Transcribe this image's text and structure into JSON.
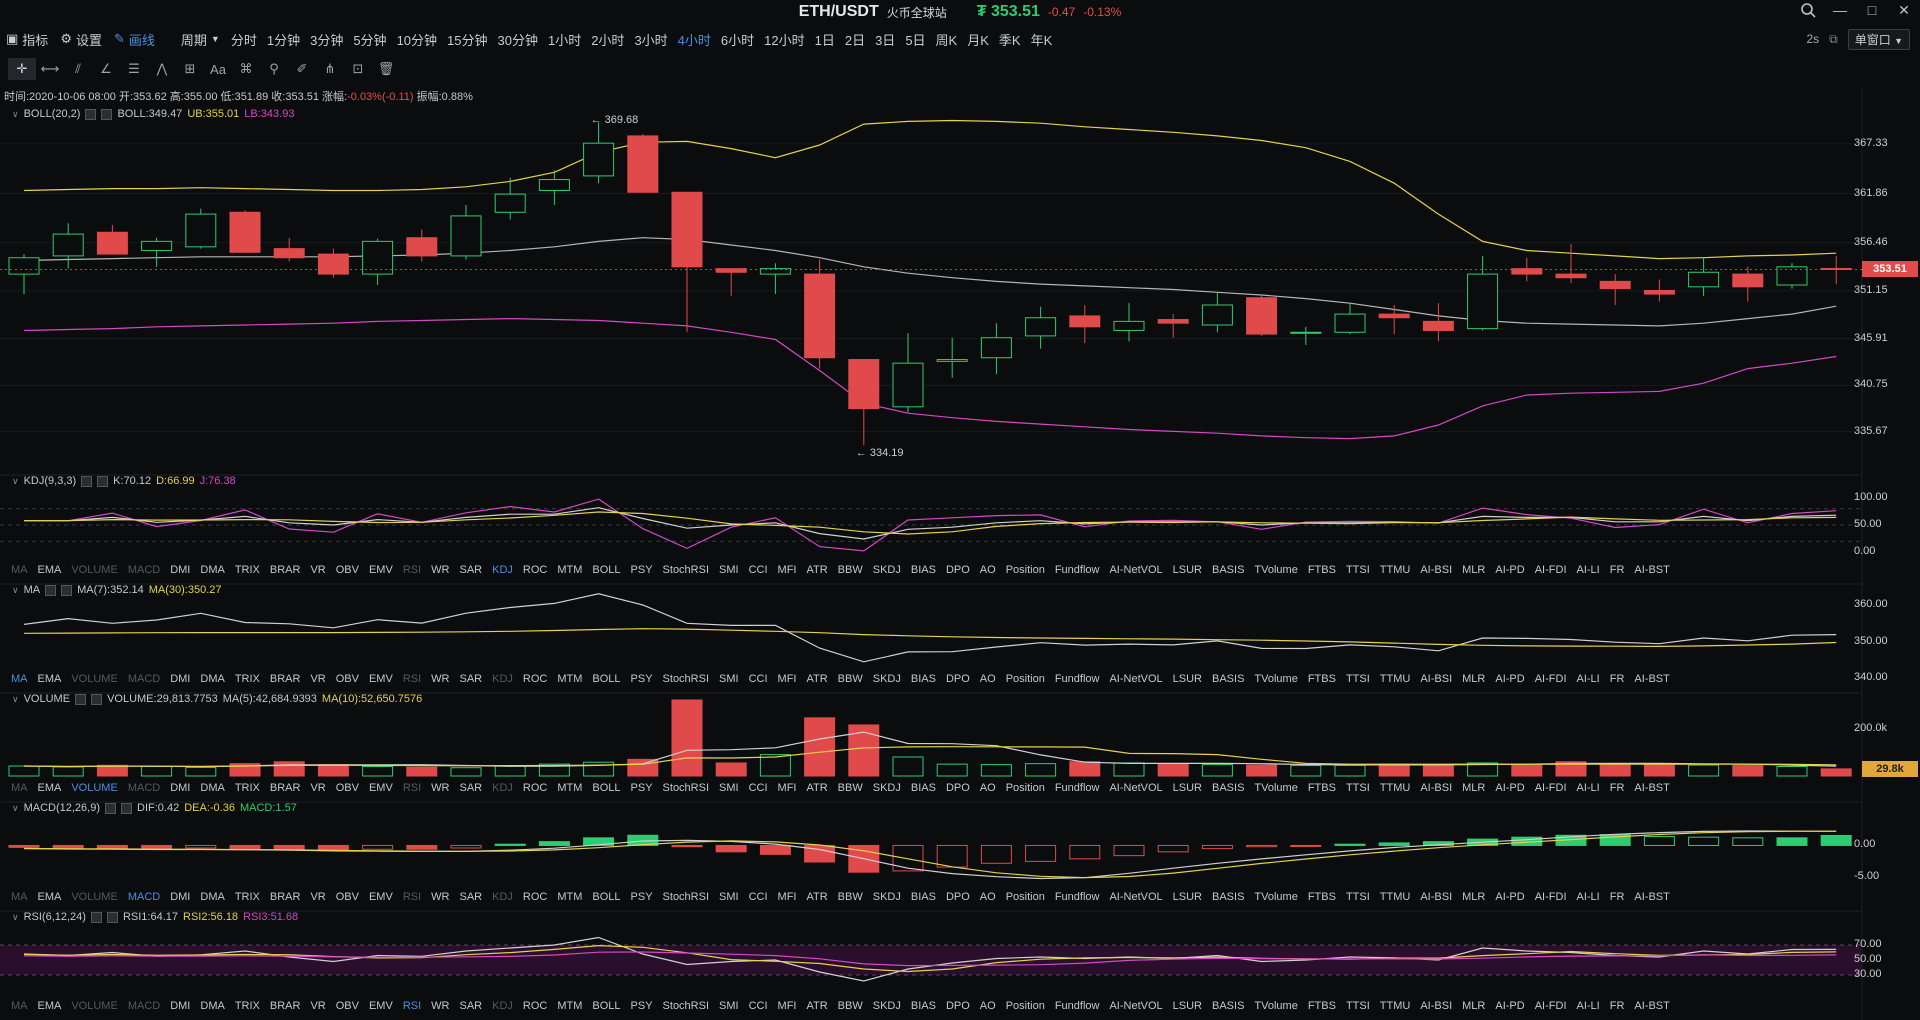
{
  "title": {
    "pair": "ETH/USDT",
    "exchange": "火币全球站",
    "price": "₮ 353.51",
    "change": "-0.47",
    "change_pct": "-0.13%"
  },
  "window_buttons": [
    "—",
    "□",
    "✕"
  ],
  "toolbar": {
    "indicator": "指标",
    "settings": "设置",
    "draw": "画线",
    "period_menu": "周期"
  },
  "periods": [
    "分时",
    "1分钟",
    "3分钟",
    "5分钟",
    "10分钟",
    "15分钟",
    "30分钟",
    "1小时",
    "2小时",
    "3小时",
    "4小时",
    "6小时",
    "12小时",
    "1日",
    "2日",
    "3日",
    "5日",
    "周K",
    "月K",
    "季K",
    "年K"
  ],
  "active_period": "4小时",
  "period_right": {
    "interval": "2s",
    "window_select": "单窗口"
  },
  "draw_tools": [
    "crosshair",
    "ray-line",
    "parallel",
    "angle",
    "fib",
    "channel",
    "rect",
    "text",
    "pattern",
    "measure",
    "brush",
    "magnet",
    "lock",
    "trash"
  ],
  "draw_text_label": "Aa",
  "info": {
    "time": "时间:2020-10-06 08:00",
    "open": "开:353.62",
    "high": "高:355.00",
    "low": "低:351.89",
    "close": "收:353.51",
    "chg_label": "涨幅:",
    "chg": "-0.03%(-0.11)",
    "amp": "振幅:0.88%"
  },
  "main": {
    "indicator": "BOLL(20,2)",
    "mid": "BOLL:349.47",
    "ub": "UB:355.01",
    "lb": "LB:343.93",
    "y_ticks": [
      "367.33",
      "361.86",
      "356.46",
      "351.15",
      "345.91",
      "340.75",
      "335.67"
    ],
    "current_price": "353.51",
    "hi_label": "← 369.68",
    "lo_label": "← 334.19",
    "colors": {
      "up": "#2ecc71",
      "down": "#e04a4a",
      "ub": "#e3d24a",
      "mid": "#b5b5b5",
      "lb": "#d548c6"
    }
  },
  "kdj": {
    "indicator": "KDJ(9,3,3)",
    "k": "K:70.12",
    "d": "D:66.99",
    "j": "J:76.38",
    "y_ticks": [
      "100.00",
      "50.00",
      "0.00"
    ]
  },
  "ma": {
    "indicator": "MA",
    "ma7": "MA(7):352.14",
    "ma30": "MA(30):350.27",
    "y_ticks": [
      "360.00",
      "350.00",
      "340.00"
    ]
  },
  "volume": {
    "indicator": "VOLUME",
    "vol": "VOLUME:29,813.7753",
    "ma5": "MA(5):42,684.9393",
    "ma10": "MA(10):52,650.7576",
    "y_ticks": [
      "200.0k"
    ],
    "current": "29.8k"
  },
  "macd": {
    "indicator": "MACD(12,26,9)",
    "dif": "DIF:0.42",
    "dea": "DEA:-0.36",
    "macd": "MACD:1.57",
    "y_ticks": [
      "0.00",
      "-5.00"
    ]
  },
  "rsi": {
    "indicator": "RSI(6,12,24)",
    "rsi1": "RSI1:64.17",
    "rsi2": "RSI2:56.18",
    "rsi3": "RSI3:51.68",
    "y_ticks": [
      "70.00",
      "50.00",
      "30.00"
    ]
  },
  "indicator_tabs": [
    "MA",
    "EMA",
    "VOLUME",
    "MACD",
    "DMI",
    "DMA",
    "TRIX",
    "BRAR",
    "VR",
    "OBV",
    "EMV",
    "RSI",
    "WR",
    "SAR",
    "KDJ",
    "ROC",
    "MTM",
    "BOLL",
    "PSY",
    "StochRSI",
    "SMI",
    "CCI",
    "MFI",
    "ATR",
    "BBW",
    "SKDJ",
    "BIAS",
    "DPO",
    "AO",
    "Position",
    "Fundflow",
    "AI-NetVOL",
    "LSUR",
    "BASIS",
    "TVolume",
    "FTBS",
    "TTSI",
    "TTMU",
    "AI-BSI",
    "MLR",
    "AI-PD",
    "AI-FDI",
    "AI-LI",
    "FR",
    "AI-BST"
  ],
  "candles": [
    [
      353.0,
      355.2,
      350.8,
      354.8
    ],
    [
      355.0,
      358.6,
      353.6,
      357.4
    ],
    [
      357.6,
      358.4,
      355.2,
      355.2
    ],
    [
      355.6,
      357.0,
      353.8,
      356.6
    ],
    [
      356.0,
      360.2,
      355.8,
      359.6
    ],
    [
      359.8,
      360.0,
      355.4,
      355.4
    ],
    [
      355.8,
      357.0,
      354.4,
      354.8
    ],
    [
      355.2,
      355.8,
      352.6,
      353.0
    ],
    [
      353.0,
      356.9,
      351.8,
      356.6
    ],
    [
      357.0,
      357.9,
      354.4,
      355.0
    ],
    [
      355.0,
      360.6,
      354.6,
      359.4
    ],
    [
      359.8,
      363.6,
      359.0,
      361.8
    ],
    [
      362.2,
      364.4,
      360.6,
      363.4
    ],
    [
      363.8,
      369.68,
      363.0,
      367.4
    ],
    [
      368.2,
      368.4,
      362.0,
      362.0
    ],
    [
      362.0,
      362.0,
      346.6,
      353.8
    ],
    [
      353.6,
      353.6,
      350.6,
      353.2
    ],
    [
      353.0,
      354.2,
      350.8,
      353.6
    ],
    [
      353.0,
      354.6,
      342.6,
      343.8
    ],
    [
      343.6,
      343.6,
      334.19,
      338.2
    ],
    [
      338.4,
      346.5,
      337.8,
      343.2
    ],
    [
      343.4,
      346.0,
      341.6,
      343.6
    ],
    [
      343.8,
      347.6,
      342.0,
      346.0
    ],
    [
      346.2,
      349.4,
      344.8,
      348.2
    ],
    [
      348.4,
      349.6,
      345.4,
      347.2
    ],
    [
      346.8,
      349.8,
      345.6,
      347.8
    ],
    [
      348.0,
      348.6,
      346.0,
      347.6
    ],
    [
      347.4,
      351.0,
      346.6,
      349.6
    ],
    [
      350.4,
      350.6,
      346.2,
      346.4
    ],
    [
      346.6,
      347.2,
      345.2,
      346.6
    ],
    [
      346.6,
      349.8,
      346.4,
      348.6
    ],
    [
      348.6,
      349.6,
      346.4,
      348.2
    ],
    [
      347.8,
      349.8,
      345.6,
      346.8
    ],
    [
      347.0,
      355.0,
      346.8,
      353.0
    ],
    [
      353.6,
      354.8,
      352.2,
      353.0
    ],
    [
      353.0,
      356.3,
      352.0,
      352.6
    ],
    [
      352.2,
      353.0,
      349.6,
      351.4
    ],
    [
      351.2,
      352.4,
      350.0,
      350.8
    ],
    [
      351.6,
      354.8,
      350.6,
      353.2
    ],
    [
      353.0,
      353.8,
      350.0,
      351.6
    ],
    [
      351.8,
      354.2,
      351.4,
      353.8
    ],
    [
      353.62,
      355.0,
      351.89,
      353.51
    ]
  ],
  "boll_ub": [
    362.2,
    362.3,
    362.4,
    362.4,
    362.5,
    362.4,
    362.3,
    362.2,
    362.2,
    362.3,
    362.6,
    363.2,
    364.2,
    366.4,
    367.5,
    367.6,
    366.8,
    365.8,
    367.2,
    369.5,
    369.8,
    369.9,
    369.8,
    369.6,
    369.2,
    368.9,
    368.6,
    368.2,
    367.7,
    366.9,
    365.4,
    363.0,
    359.6,
    356.6,
    355.6,
    355.3,
    355.0,
    354.7,
    354.8,
    355.0,
    355.1,
    355.3
  ],
  "boll_mid": [
    354.5,
    354.6,
    354.7,
    354.8,
    354.9,
    354.9,
    354.9,
    354.9,
    355.0,
    355.1,
    355.3,
    355.6,
    356.0,
    356.6,
    357.0,
    356.8,
    356.2,
    355.6,
    354.8,
    353.8,
    353.1,
    352.6,
    352.2,
    351.9,
    351.7,
    351.5,
    351.3,
    351.0,
    350.7,
    350.3,
    349.8,
    349.1,
    348.4,
    347.9,
    347.6,
    347.5,
    347.4,
    347.3,
    347.6,
    348.1,
    348.6,
    349.47
  ],
  "boll_lb": [
    346.8,
    346.9,
    347.0,
    347.2,
    347.3,
    347.4,
    347.5,
    347.6,
    347.8,
    347.9,
    348.0,
    348.1,
    348.0,
    347.9,
    347.6,
    347.3,
    346.6,
    345.8,
    342.4,
    338.8,
    337.7,
    337.2,
    336.8,
    336.5,
    336.2,
    335.9,
    335.7,
    335.5,
    335.2,
    335.0,
    334.9,
    335.2,
    336.4,
    338.5,
    339.7,
    339.9,
    340.0,
    340.1,
    341.0,
    342.6,
    343.2,
    343.93
  ],
  "volumes": [
    42,
    38,
    45,
    40,
    36,
    52,
    60,
    48,
    40,
    37,
    35,
    44,
    50,
    58,
    70,
    320,
    55,
    90,
    245,
    215,
    80,
    50,
    48,
    52,
    60,
    55,
    50,
    48,
    46,
    44,
    45,
    50,
    48,
    55,
    50,
    60,
    52,
    48,
    46,
    44,
    40,
    30
  ],
  "macd_hist": [
    -0.3,
    -0.4,
    -0.4,
    -0.5,
    -0.4,
    -0.5,
    -0.6,
    -0.8,
    -0.6,
    -0.6,
    -0.4,
    0.2,
    0.6,
    1.2,
    1.6,
    -0.2,
    -1.0,
    -1.4,
    -2.6,
    -4.2,
    -4.0,
    -3.4,
    -2.8,
    -2.5,
    -2.1,
    -1.6,
    -1.0,
    -0.5,
    -0.2,
    -0.1,
    0.2,
    0.4,
    0.6,
    1.0,
    1.3,
    1.6,
    1.7,
    1.4,
    1.3,
    1.2,
    1.2,
    1.57
  ],
  "rsi1": [
    58,
    56,
    60,
    55,
    57,
    62,
    54,
    48,
    56,
    55,
    62,
    66,
    70,
    80,
    58,
    44,
    48,
    50,
    34,
    22,
    38,
    46,
    52,
    54,
    52,
    54,
    52,
    56,
    48,
    50,
    54,
    53,
    50,
    66,
    62,
    60,
    56,
    54,
    62,
    58,
    64,
    64.17
  ]
}
